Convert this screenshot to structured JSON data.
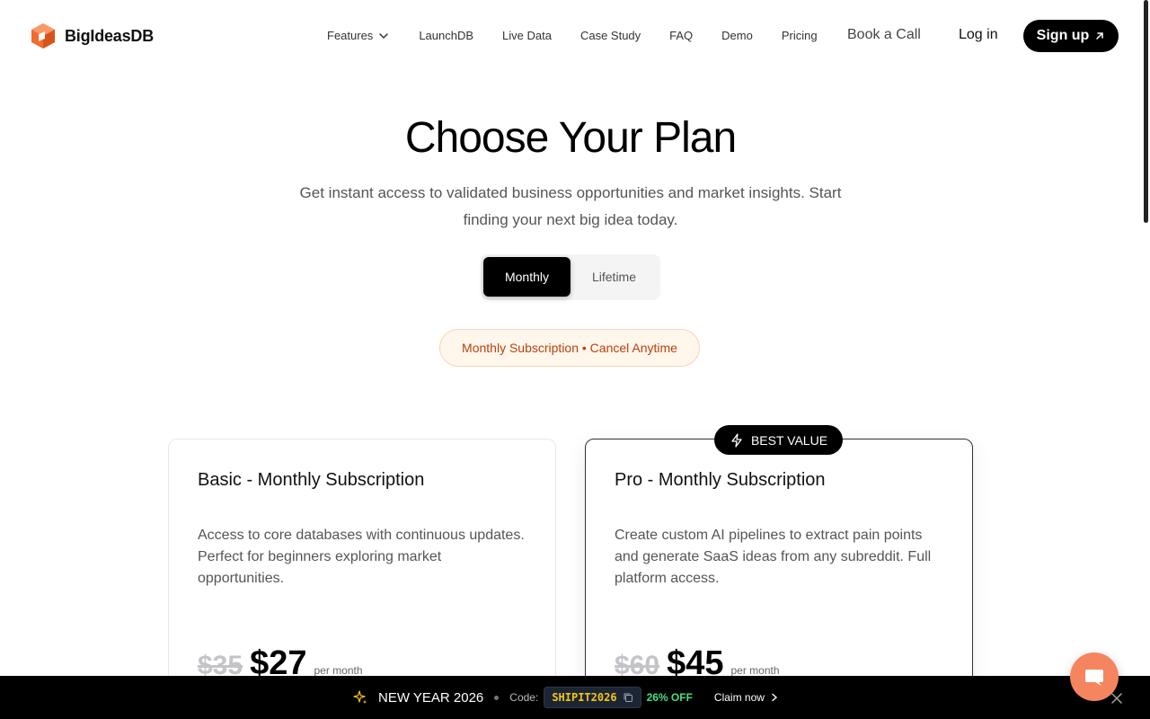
{
  "brand": {
    "name": "BigIdeasDB",
    "accent": "#f26b2f"
  },
  "nav": {
    "items": [
      {
        "label": "Features",
        "has_dropdown": true
      },
      {
        "label": "LaunchDB"
      },
      {
        "label": "Live Data"
      },
      {
        "label": "Case Study"
      },
      {
        "label": "FAQ"
      },
      {
        "label": "Demo"
      },
      {
        "label": "Pricing"
      }
    ],
    "book_call": "Book a Call",
    "login": "Log in",
    "signup": "Sign up"
  },
  "hero": {
    "title": "Choose Your Plan",
    "subtitle": "Get instant access to validated business opportunities and market insights. Start finding your next big idea today."
  },
  "billing_toggle": {
    "options": [
      "Monthly",
      "Lifetime"
    ],
    "selected": "Monthly"
  },
  "notice": "Monthly Subscription • Cancel Anytime",
  "plans": [
    {
      "title": "Basic - Monthly Subscription",
      "description": "Access to core databases with continuous updates. Perfect for beginners exploring market opportunities.",
      "old_price": "$35",
      "price": "$27",
      "period": "per month"
    },
    {
      "title": "Pro - Monthly Subscription",
      "description": "Create custom AI pipelines to extract pain points and generate SaaS ideas from any subreddit. Full platform access.",
      "old_price": "$60",
      "price": "$45",
      "period": "per month",
      "badge": "BEST VALUE"
    }
  ],
  "promo": {
    "title": "NEW YEAR 2026",
    "code_label": "Code:",
    "code": "SHIPIT2026",
    "discount": "26% OFF",
    "cta": "Claim now",
    "icon": "sparkle-icon",
    "code_color": "#f5c518",
    "discount_color": "#4ade80"
  },
  "chat": {
    "icon": "chat-icon",
    "color": "#f5855f"
  }
}
